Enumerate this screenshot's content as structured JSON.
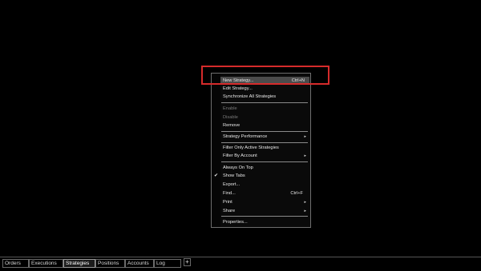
{
  "menu": {
    "items": [
      {
        "label": "New Strategy...",
        "shortcut": "Ctrl+N"
      },
      {
        "label": "Edit Strategy..."
      },
      {
        "label": "Synchronize All Strategies"
      },
      {
        "label": "Enable"
      },
      {
        "label": "Disable"
      },
      {
        "label": "Remove"
      },
      {
        "label": "Strategy Performance"
      },
      {
        "label": "Filter Only Active Strategies"
      },
      {
        "label": "Filter By Account"
      },
      {
        "label": "Always On Top"
      },
      {
        "label": "Show Tabs"
      },
      {
        "label": "Export..."
      },
      {
        "label": "Find...",
        "shortcut": "Ctrl+F"
      },
      {
        "label": "Print"
      },
      {
        "label": "Share"
      },
      {
        "label": "Properties..."
      }
    ],
    "submenu_arrow": "▸",
    "check_glyph": "✔"
  },
  "tabs": {
    "items": [
      {
        "label": "Orders"
      },
      {
        "label": "Executions"
      },
      {
        "label": "Strategies"
      },
      {
        "label": "Positions"
      },
      {
        "label": "Accounts"
      },
      {
        "label": "Log"
      }
    ],
    "add_label": "+"
  },
  "colors": {
    "highlight_border": "#d62b2b",
    "menu_hover": "#4b4b4b"
  }
}
